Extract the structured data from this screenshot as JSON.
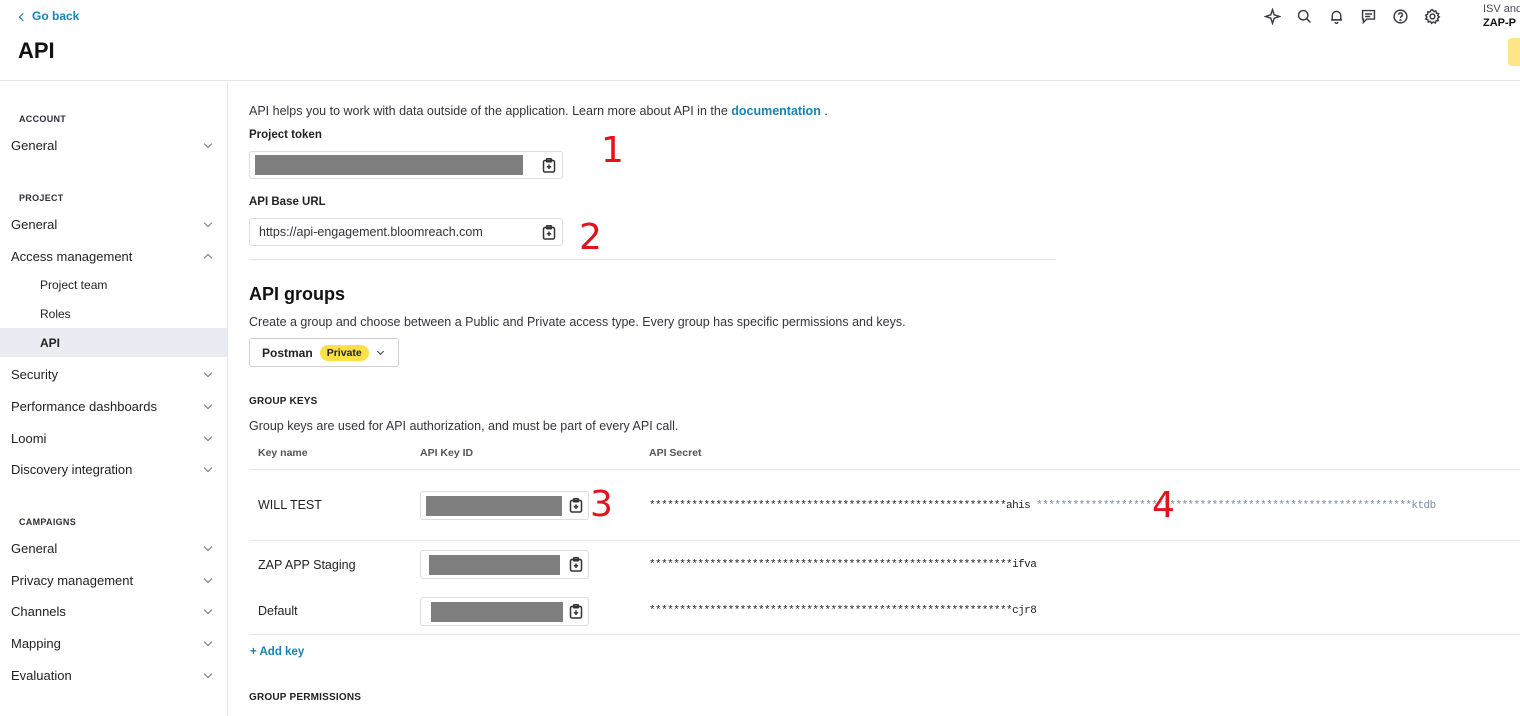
{
  "header": {
    "back_label": "Go back",
    "title": "API",
    "icons": [
      "sparkle-icon",
      "search-icon",
      "bell-icon",
      "chat-icon",
      "help-icon",
      "gear-icon"
    ],
    "org_sub": "ISV and",
    "org_name": "ZAP-P"
  },
  "sidebar": {
    "sections": {
      "account": "ACCOUNT",
      "project": "PROJECT",
      "campaigns": "CAMPAIGNS"
    },
    "account_items": [
      "General"
    ],
    "project_items": [
      "General",
      "Access management"
    ],
    "access_sub": [
      "Project team",
      "Roles",
      "API"
    ],
    "active_sub": "API",
    "project_items_after": [
      "Security",
      "Performance dashboards",
      "Loomi",
      "Discovery integration"
    ],
    "campaign_items": [
      "General",
      "Privacy management",
      "Channels",
      "Mapping",
      "Evaluation"
    ]
  },
  "main": {
    "intro_text": "API helps you to work with data outside of the application. Learn more about API in the ",
    "intro_link": "documentation",
    "intro_end": " .",
    "project_token_label": "Project token",
    "base_url_label": "API Base URL",
    "base_url_value": "https://api-engagement.bloomreach.com",
    "groups_title": "API groups",
    "groups_desc": "Create a group and choose between a Public and Private access type. Every group has specific permissions and keys.",
    "group_selected": "Postman",
    "group_badge": "Private",
    "group_keys_label": "GROUP KEYS",
    "group_keys_desc": "Group keys are used for API authorization, and must be part of every API call.",
    "columns": [
      "Key name",
      "API Key ID",
      "API Secret"
    ],
    "keys": [
      {
        "name": "WILL TEST",
        "secret": "***********************************************************ahis",
        "secret_extra": " **************************************************************ktdb"
      },
      {
        "name": "ZAP APP Staging",
        "secret": "************************************************************ifva",
        "secret_extra": ""
      },
      {
        "name": "Default",
        "secret": "************************************************************cjr8",
        "secret_extra": ""
      }
    ],
    "add_key_label": "+ Add key",
    "group_permissions_label": "GROUP PERMISSIONS"
  },
  "annotations": [
    "1",
    "2",
    "3",
    "4"
  ],
  "colors": {
    "accent": "#1783b3",
    "badge": "#fde047",
    "annotation": "#e3121b",
    "redaction": "#7f7f7f"
  }
}
